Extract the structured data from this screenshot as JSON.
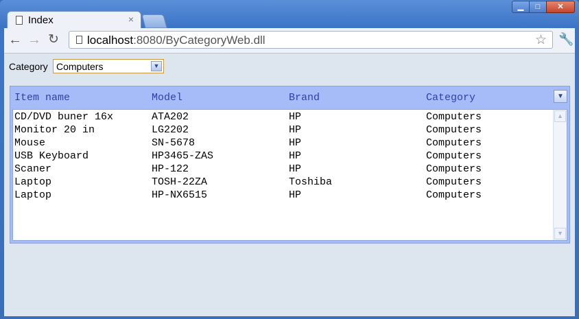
{
  "window": {
    "tab_title": "Index",
    "tab_close": "×",
    "controls": {
      "minimize": "▁",
      "maximize": "□",
      "close": "✕"
    }
  },
  "toolbar": {
    "back_icon": "arrow-left",
    "forward_icon": "arrow-right",
    "reload_icon": "reload",
    "url_host": "localhost",
    "url_rest": ":8080/ByCategoryWeb.dll"
  },
  "filter": {
    "label": "Category",
    "selected": "Computers"
  },
  "grid": {
    "columns": [
      "Item name",
      "Model",
      "Brand",
      "Category"
    ],
    "rows": [
      [
        "CD/DVD buner 16x",
        "ATA202",
        "HP",
        "Computers"
      ],
      [
        "Monitor 20 in",
        "LG2202",
        "HP",
        "Computers"
      ],
      [
        "Mouse",
        "SN-5678",
        "HP",
        "Computers"
      ],
      [
        "USB Keyboard",
        "HP3465-ZAS",
        "HP",
        "Computers"
      ],
      [
        "Scaner",
        "HP-122",
        "HP",
        "Computers"
      ],
      [
        "Laptop",
        "TOSH-22ZA",
        "Toshiba",
        "Computers"
      ],
      [
        "Laptop",
        "HP-NX6515",
        "HP",
        "Computers"
      ]
    ]
  }
}
